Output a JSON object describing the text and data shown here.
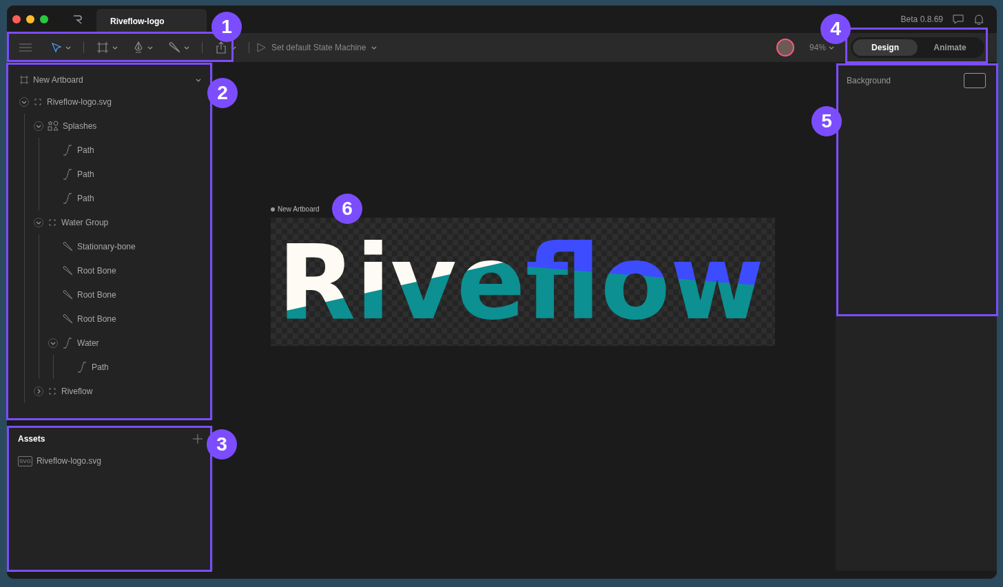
{
  "window": {
    "tab_title": "Riveflow-logo",
    "version": "Beta 0.8.69"
  },
  "toolbar": {
    "state_machine": "Set default State Machine",
    "zoom": "94%",
    "tools": [
      {
        "kind": "select",
        "selected": true
      },
      {
        "kind": "artboard",
        "selected": false
      },
      {
        "kind": "pen",
        "selected": false
      },
      {
        "kind": "bone",
        "selected": false
      },
      {
        "kind": "export",
        "selected": false
      }
    ]
  },
  "modes": [
    {
      "label": "Design",
      "selected": true
    },
    {
      "label": "Animate",
      "selected": false
    }
  ],
  "hierarchy": {
    "artboard": "New Artboard",
    "tree": [
      {
        "label": "Riveflow-logo.svg",
        "kind": "group",
        "expanded": true,
        "children": [
          {
            "label": "Splashes",
            "kind": "shapes",
            "expanded": true,
            "children": [
              {
                "label": "Path",
                "kind": "path"
              },
              {
                "label": "Path",
                "kind": "path"
              },
              {
                "label": "Path",
                "kind": "path"
              }
            ]
          },
          {
            "label": "Water Group",
            "kind": "group",
            "expanded": true,
            "children": [
              {
                "label": "Stationary-bone",
                "kind": "bone"
              },
              {
                "label": "Root Bone",
                "kind": "bone"
              },
              {
                "label": "Root Bone",
                "kind": "bone"
              },
              {
                "label": "Root Bone",
                "kind": "bone"
              },
              {
                "label": "Water",
                "kind": "path",
                "expanded": true,
                "children": [
                  {
                    "label": "Path",
                    "kind": "path"
                  }
                ]
              }
            ]
          },
          {
            "label": "Riveflow",
            "kind": "group",
            "expanded": false
          }
        ]
      }
    ]
  },
  "assets": {
    "title": "Assets",
    "items": [
      {
        "label": "Riveflow-logo.svg",
        "badge": "SVG"
      }
    ]
  },
  "inspector": {
    "background_label": "Background"
  },
  "canvas": {
    "artboard_label": "New Artboard",
    "logo_text": "Riveflow"
  },
  "callouts": [
    "1",
    "2",
    "3",
    "4",
    "5",
    "6"
  ]
}
